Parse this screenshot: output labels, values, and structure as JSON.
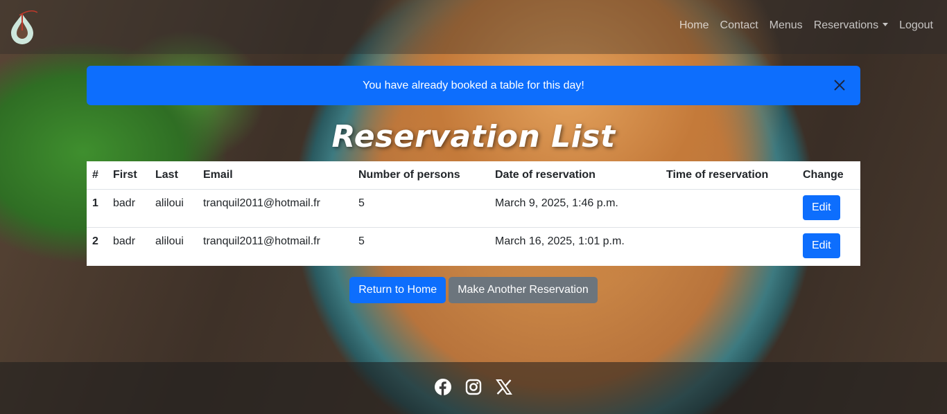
{
  "nav": {
    "links": [
      "Home",
      "Contact",
      "Menus",
      "Reservations",
      "Logout"
    ]
  },
  "alert": {
    "message": "You have already booked a table for this day!",
    "color": "#0d6efd"
  },
  "title": "Reservation List",
  "table": {
    "headers": [
      "#",
      "First",
      "Last",
      "Email",
      "Number of persons",
      "Date of reservation",
      "Time of reservation",
      "Change"
    ],
    "rows": [
      {
        "num": "1",
        "first": "badr",
        "last": "aliloui",
        "email": "tranquil2011@hotmail.fr",
        "persons": "5",
        "date": "March 9, 2025, 1:46 p.m.",
        "time": "",
        "action": "Edit"
      },
      {
        "num": "2",
        "first": "badr",
        "last": "aliloui",
        "email": "tranquil2011@hotmail.fr",
        "persons": "5",
        "date": "March 16, 2025, 1:01 p.m.",
        "time": "",
        "action": "Edit"
      }
    ]
  },
  "actions": {
    "home": "Return to Home",
    "another": "Make Another Reservation"
  },
  "footer": {
    "icons": [
      "facebook-icon",
      "instagram-icon",
      "x-icon"
    ]
  }
}
